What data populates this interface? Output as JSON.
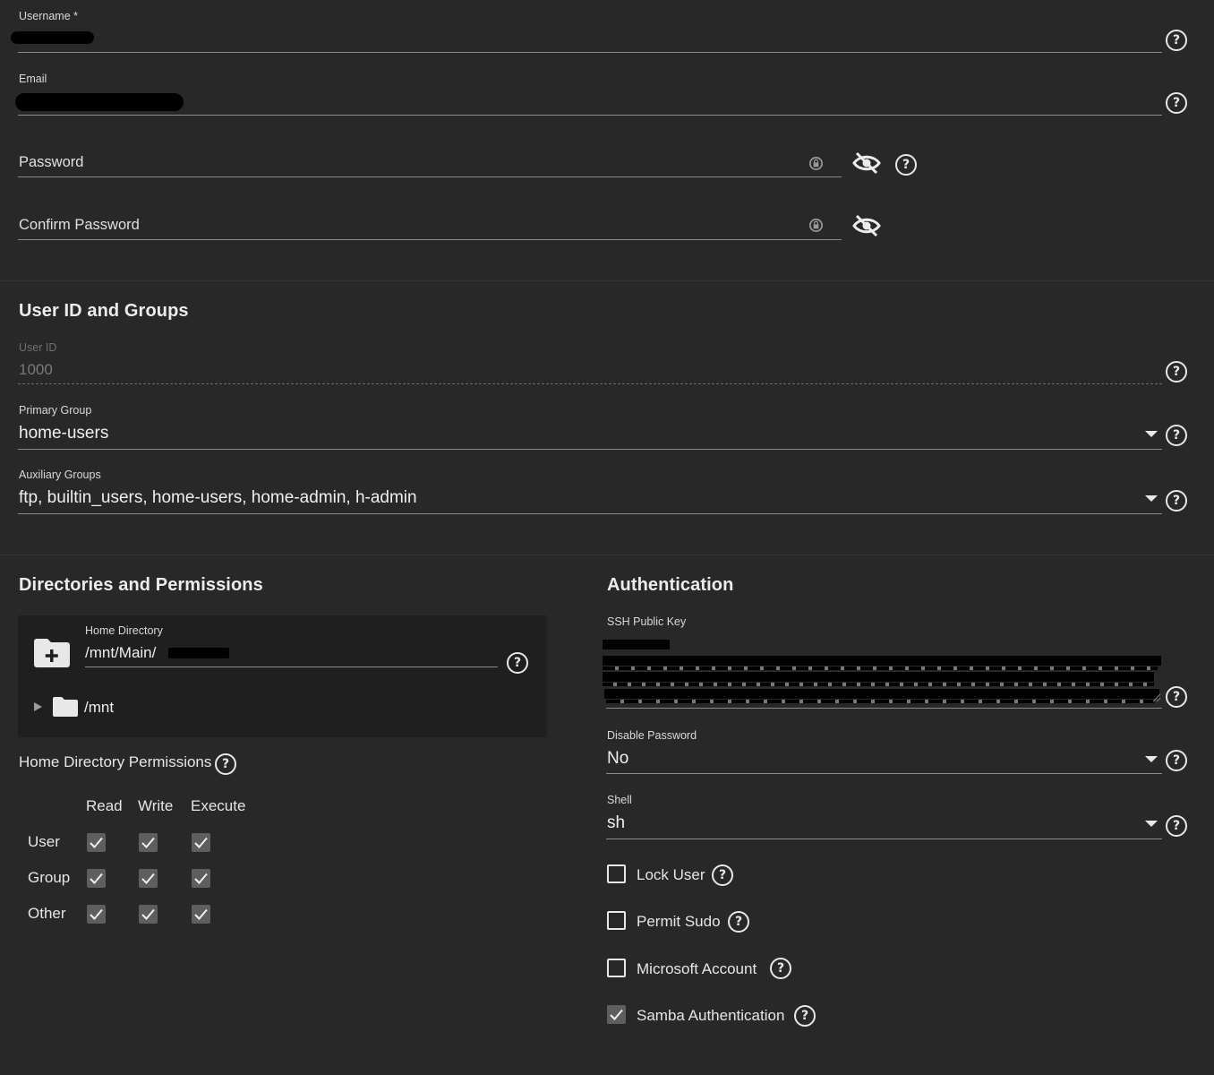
{
  "account": {
    "username_label": "Username *",
    "email_label": "Email",
    "password_placeholder": "Password",
    "confirm_password_placeholder": "Confirm Password"
  },
  "ids_groups": {
    "title": "User ID and Groups",
    "user_id_label": "User ID",
    "user_id_value": "1000",
    "primary_group_label": "Primary Group",
    "primary_group_value": "home-users",
    "aux_groups_label": "Auxiliary Groups",
    "aux_groups_value": "ftp, builtin_users, home-users, home-admin, h-admin"
  },
  "directories": {
    "title": "Directories and Permissions",
    "home_dir_label": "Home Directory",
    "home_dir_value": "/mnt/Main/",
    "tree_root": "/mnt",
    "permissions_label": "Home Directory Permissions",
    "columns": [
      "Read",
      "Write",
      "Execute"
    ],
    "rows": [
      {
        "label": "User",
        "read": true,
        "write": true,
        "execute": true
      },
      {
        "label": "Group",
        "read": true,
        "write": true,
        "execute": true
      },
      {
        "label": "Other",
        "read": true,
        "write": true,
        "execute": true
      }
    ]
  },
  "authentication": {
    "title": "Authentication",
    "ssh_key_label": "SSH Public Key",
    "disable_password_label": "Disable Password",
    "disable_password_value": "No",
    "shell_label": "Shell",
    "shell_value": "sh",
    "options": [
      {
        "label": "Lock User",
        "checked": false
      },
      {
        "label": "Permit Sudo",
        "checked": false
      },
      {
        "label": "Microsoft Account",
        "checked": false
      },
      {
        "label": "Samba Authentication",
        "checked": true
      }
    ]
  },
  "icons": {
    "help": "help-circle-icon",
    "visibility": "eye-off-icon",
    "password_generate": "lock-refresh-icon",
    "dropdown": "caret-down-icon",
    "folder_add": "folder-plus-icon",
    "folder": "folder-icon",
    "expand": "caret-right-icon",
    "check": "checkmark-icon"
  },
  "colors": {
    "background": "#282828",
    "text": "#e6e6e6",
    "panel": "#1f1f1f",
    "checkbox_checked": "#5e5e5e"
  }
}
